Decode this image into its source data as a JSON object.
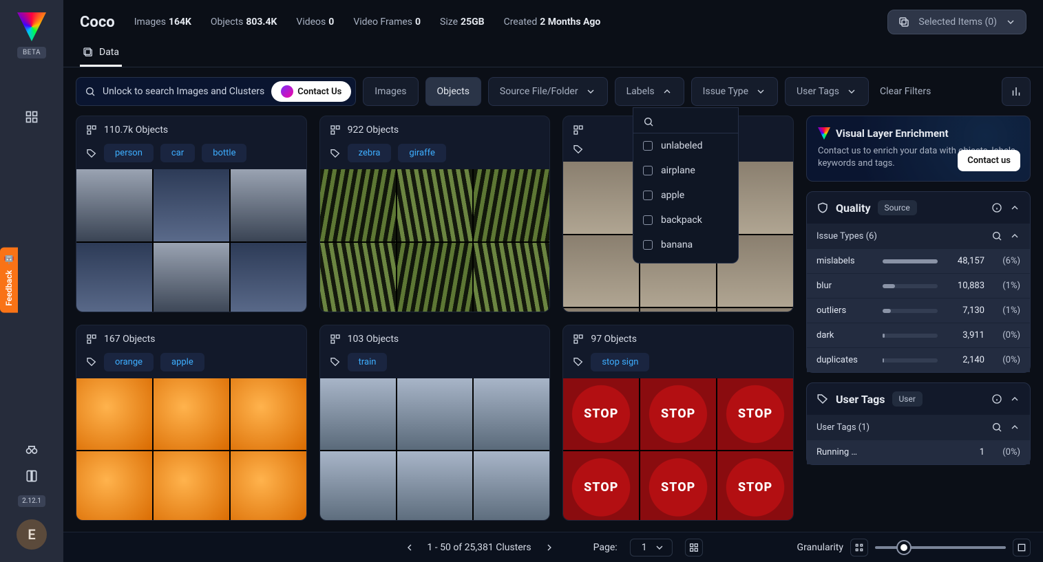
{
  "rail": {
    "beta": "BETA",
    "version": "2.12.1",
    "avatar_initial": "E",
    "feedback": "Feedback"
  },
  "header": {
    "title": "Coco",
    "metrics": {
      "images_label": "Images",
      "images_value": "164K",
      "objects_label": "Objects",
      "objects_value": "803.4K",
      "videos_label": "Videos",
      "videos_value": "0",
      "frames_label": "Video Frames",
      "frames_value": "0",
      "size_label": "Size",
      "size_value": "25GB",
      "created_label": "Created",
      "created_value": "2 Months Ago"
    },
    "selected_label": "Selected Items (0)"
  },
  "tabs": {
    "data": "Data"
  },
  "filters": {
    "search_text": "Unlock to search Images and Clusters",
    "contact_us": "Contact Us",
    "images": "Images",
    "objects": "Objects",
    "source_file": "Source File/Folder",
    "labels": "Labels",
    "issue_type": "Issue Type",
    "user_tags": "User Tags",
    "clear": "Clear Filters",
    "dropdown_items": [
      "unlabeled",
      "airplane",
      "apple",
      "backpack",
      "banana"
    ]
  },
  "clusters": [
    {
      "count": "110.7k Objects",
      "tags": [
        "person",
        "car",
        "bottle"
      ],
      "theme": "car"
    },
    {
      "count": "922 Objects",
      "tags": [
        "zebra",
        "giraffe"
      ],
      "theme": "zebra"
    },
    {
      "count": "",
      "tags": [],
      "theme": "ele"
    },
    {
      "count": "167 Objects",
      "tags": [
        "orange",
        "apple"
      ],
      "theme": "orange"
    },
    {
      "count": "103 Objects",
      "tags": [
        "train"
      ],
      "theme": "train"
    },
    {
      "count": "97 Objects",
      "tags": [
        "stop sign"
      ],
      "theme": "stop"
    }
  ],
  "enrich": {
    "title": "Visual Layer Enrichment",
    "body": "Contact us to enrich your data with objects, labels, keywords and tags.",
    "btn": "Contact us"
  },
  "quality": {
    "title": "Quality",
    "pill": "Source",
    "subheader": "Issue Types  (6)",
    "rows": [
      {
        "label": "mislabels",
        "count": "48,157",
        "pct": "(6%)",
        "fill": 100
      },
      {
        "label": "blur",
        "count": "10,883",
        "pct": "(1%)",
        "fill": 22
      },
      {
        "label": "outliers",
        "count": "7,130",
        "pct": "(1%)",
        "fill": 15
      },
      {
        "label": "dark",
        "count": "3,911",
        "pct": "(0%)",
        "fill": 4
      },
      {
        "label": "duplicates",
        "count": "2,140",
        "pct": "(0%)",
        "fill": 2
      }
    ]
  },
  "usertags": {
    "title": "User Tags",
    "pill": "User",
    "subheader": "User Tags  (1)",
    "rows": [
      {
        "label": "Running …",
        "count": "1",
        "pct": "(0%)"
      }
    ]
  },
  "footer": {
    "range": "1 - 50 of 25,381 Clusters",
    "page_label": "Page:",
    "page_value": "1",
    "granularity": "Granularity"
  }
}
